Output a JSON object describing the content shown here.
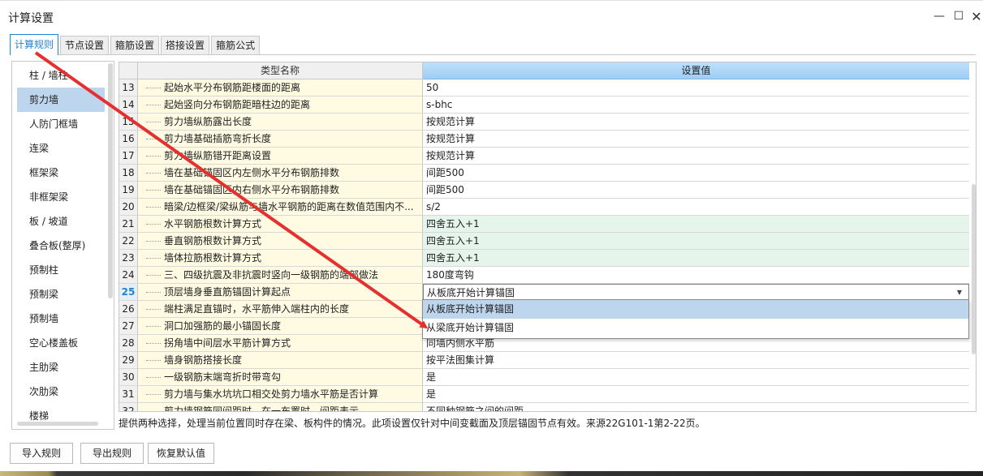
{
  "window": {
    "title": "计算设置",
    "minimize_glyph": "—",
    "maximize_glyph": "☐",
    "close_glyph": "✕"
  },
  "tabs": [
    {
      "label": "计算规则",
      "active": true
    },
    {
      "label": "节点设置",
      "active": false
    },
    {
      "label": "箍筋设置",
      "active": false
    },
    {
      "label": "搭接设置",
      "active": false
    },
    {
      "label": "箍筋公式",
      "active": false
    }
  ],
  "sidebar": {
    "items": [
      {
        "label": "柱 / 墙柱"
      },
      {
        "label": "剪力墙",
        "selected": true
      },
      {
        "label": "人防门框墙"
      },
      {
        "label": "连梁"
      },
      {
        "label": "框架梁"
      },
      {
        "label": "非框架梁"
      },
      {
        "label": "板 / 坡道"
      },
      {
        "label": "叠合板(整厚)"
      },
      {
        "label": "预制柱"
      },
      {
        "label": "预制梁"
      },
      {
        "label": "预制墙"
      },
      {
        "label": "空心楼盖板"
      },
      {
        "label": "主肋梁"
      },
      {
        "label": "次肋梁"
      },
      {
        "label": "楼梯"
      }
    ]
  },
  "grid": {
    "columns": {
      "name": "类型名称",
      "value": "设置值"
    },
    "current_row": "25",
    "rows": [
      {
        "num": "13",
        "name": "起始水平分布钢筋距楼面的距离",
        "value": "50"
      },
      {
        "num": "14",
        "name": "起始竖向分布钢筋距暗柱边的距离",
        "value": "s-bhc"
      },
      {
        "num": "15",
        "name": "剪力墙纵筋露出长度",
        "value": "按规范计算"
      },
      {
        "num": "16",
        "name": "剪力墙基础插筋弯折长度",
        "value": "按规范计算"
      },
      {
        "num": "17",
        "name": "剪力墙纵筋错开距离设置",
        "value": "按规范计算"
      },
      {
        "num": "18",
        "name": "墙在基础锚固区内左侧水平分布钢筋排数",
        "value": "间距500"
      },
      {
        "num": "19",
        "name": "墙在基础锚固区内右侧水平分布钢筋排数",
        "value": "间距500"
      },
      {
        "num": "20",
        "name": "暗梁/边框梁/梁纵筋与墙水平钢筋的距离在数值范围内不...",
        "value": "s/2"
      },
      {
        "num": "21",
        "name": "水平钢筋根数计算方式",
        "value": "四舍五入+1",
        "green": true
      },
      {
        "num": "22",
        "name": "垂直钢筋根数计算方式",
        "value": "四舍五入+1",
        "green": true
      },
      {
        "num": "23",
        "name": "墙体拉筋根数计算方式",
        "value": "四舍五入+1",
        "green": true
      },
      {
        "num": "24",
        "name": "三、四级抗震及非抗震时竖向一级钢筋的端部做法",
        "value": "180度弯钩"
      },
      {
        "num": "25",
        "name": "顶层墙身垂直筋锚固计算起点",
        "value": "从板底开始计算锚固",
        "editing": true
      },
      {
        "num": "26",
        "name": "端柱满足直锚时，水平筋伸入端柱内的长度",
        "value": ""
      },
      {
        "num": "27",
        "name": "洞口加强筋的最小锚固长度",
        "value": ""
      },
      {
        "num": "28",
        "name": "拐角墙中间层水平筋计算方式",
        "value": "同墙内侧水平筋"
      },
      {
        "num": "29",
        "name": "墙身钢筋搭接长度",
        "value": "按平法图集计算"
      },
      {
        "num": "30",
        "name": "一级钢筋末端弯折时带弯勾",
        "value": "是"
      },
      {
        "num": "31",
        "name": "剪力墙与集水坑坑口相交处剪力墙水平筋是否计算",
        "value": "是"
      },
      {
        "num": "32",
        "name": "剪力墙钢筋同间距时，在一布置时，间距表示",
        "value": "不同种钢筋之间的间距"
      }
    ]
  },
  "dropdown": {
    "options": [
      {
        "label": "从板底开始计算锚固",
        "hover": true
      },
      {
        "label": "从梁底开始计算锚固",
        "hover": false
      }
    ]
  },
  "description": "提供两种选择，处理当前位置同时存在梁、板构件的情况。此项设置仅针对中间变截面及顶层锚固节点有效。来源22G101-1第2-22页。",
  "buttons": {
    "import": "导入规则",
    "export": "导出规则",
    "restore": "恢复默认值"
  },
  "colors": {
    "accent": "#1f82d2",
    "selected": "#bdd6ee",
    "name_cell": "#fffbe3",
    "green_cell": "#e5f5ec",
    "annotation": "#e53030"
  }
}
